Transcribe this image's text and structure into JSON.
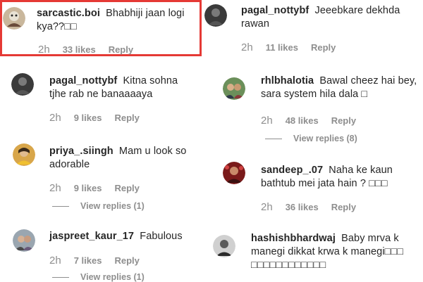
{
  "comments": [
    {
      "username": "sarcastic.boi",
      "text": "Bhabhiji jaan logi kya??□□",
      "time": "2h",
      "likes": "33 likes",
      "reply": "Reply"
    },
    {
      "username": "pagal_nottybf",
      "text": "Jeeebkare dekhda rawan",
      "time": "2h",
      "likes": "11 likes",
      "reply": "Reply"
    },
    {
      "username": "pagal_nottybf",
      "text": "Kitna sohna tjhe rab ne banaaaaya",
      "time": "2h",
      "likes": "9 likes",
      "reply": "Reply"
    },
    {
      "username": "rhlbhalotia",
      "text": "Bawal cheez hai bey, sara system hila dala □",
      "time": "2h",
      "likes": "48 likes",
      "reply": "Reply",
      "view_replies": "View replies (8)"
    },
    {
      "username": "priya_.siingh",
      "text": "Mam u look so adorable",
      "time": "2h",
      "likes": "9 likes",
      "reply": "Reply",
      "view_replies": "View replies (1)"
    },
    {
      "username": "sandeep_.07",
      "text": "Naha ke kaun bathtub mei jata hain ? □□□",
      "time": "2h",
      "likes": "36 likes",
      "reply": "Reply"
    },
    {
      "username": "jaspreet_kaur_17",
      "text": "Fabulous",
      "time": "2h",
      "likes": "7 likes",
      "reply": "Reply",
      "view_replies": "View replies (1)"
    },
    {
      "username": "hashishbhardwaj",
      "text": "Baby mrva k manegi dikkat krwa k manegi□□□ □□□□□□□□□□□□",
      "time": "",
      "likes": "",
      "reply": ""
    }
  ],
  "colors": {
    "highlight": "#e53935",
    "username": "#262626",
    "meta": "#8e8e8e"
  }
}
